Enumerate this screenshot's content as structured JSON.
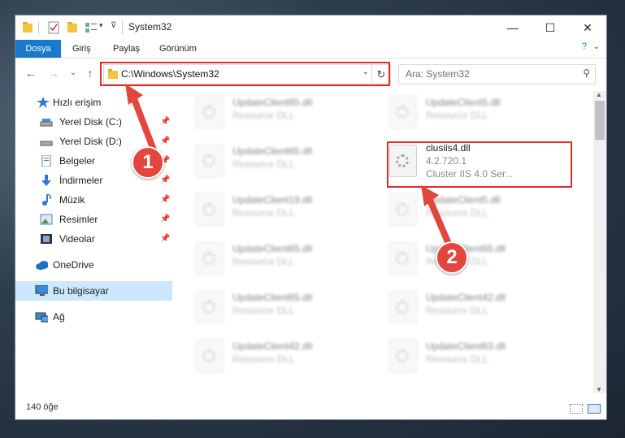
{
  "window": {
    "title": "System32",
    "controls": {
      "minimize": "—",
      "maximize": "☐",
      "close": "✕"
    }
  },
  "ribbon": {
    "tabs": [
      {
        "label": "Dosya"
      },
      {
        "label": "Giriş"
      },
      {
        "label": "Paylaş"
      },
      {
        "label": "Görünüm"
      }
    ]
  },
  "address": {
    "path": "C:\\Windows\\System32",
    "refresh_icon": "↻",
    "dropdown_icon": "⌄"
  },
  "search": {
    "placeholder": "Ara: System32",
    "icon": "⚲"
  },
  "nav_buttons": {
    "back": "←",
    "forward": "→",
    "recent": "⌄",
    "up": "↑"
  },
  "sidebar": {
    "pin_icon": "📌",
    "items": [
      {
        "label": "Hızlı erişim",
        "icon": "star-icon"
      },
      {
        "label": "Yerel Disk (C:)",
        "icon": "drive-icon",
        "pinned": true
      },
      {
        "label": "Yerel Disk (D:)",
        "icon": "drive-icon",
        "pinned": true
      },
      {
        "label": "Belgeler",
        "icon": "documents-icon",
        "pinned": true
      },
      {
        "label": "İndirmeler",
        "icon": "download-icon",
        "pinned": true
      },
      {
        "label": "Müzik",
        "icon": "music-icon",
        "pinned": true
      },
      {
        "label": "Resimler",
        "icon": "pictures-icon",
        "pinned": true
      },
      {
        "label": "Videolar",
        "icon": "videos-icon",
        "pinned": true
      },
      {
        "label": "OneDrive",
        "icon": "cloud-icon"
      },
      {
        "label": "Bu bilgisayar",
        "icon": "computer-icon",
        "selected": true
      },
      {
        "label": "Ağ",
        "icon": "network-icon"
      }
    ]
  },
  "files": [
    {
      "name": "UpdateClient65.dll",
      "desc": "Resource DLL",
      "blurred": true
    },
    {
      "name": "UpdateClient5.dll",
      "desc": "Resource DLL",
      "blurred": true
    },
    {
      "name": "UpdateClient65.dll",
      "desc": "Resource DLL",
      "blurred": true
    },
    {
      "name": "clusiis4.dll",
      "version": "4.2.720.1",
      "desc": "Cluster IIS 4.0 Ser...",
      "blurred": false
    },
    {
      "name": "UpdateClient19.dll",
      "desc": "Resource DLL",
      "blurred": true
    },
    {
      "name": "UpdateClient5.dll",
      "desc": "Resource DLL",
      "blurred": true
    },
    {
      "name": "UpdateClient65.dll",
      "desc": "Resource DLL",
      "blurred": true
    },
    {
      "name": "UpdateClient65.dll",
      "desc": "Resource DLL",
      "blurred": true
    },
    {
      "name": "UpdateClient65.dll",
      "desc": "Resource DLL",
      "blurred": true
    },
    {
      "name": "UpdateClient42.dll",
      "desc": "Resource DLL",
      "blurred": true
    },
    {
      "name": "UpdateClient42.dll",
      "desc": "Resource DLL",
      "blurred": true
    },
    {
      "name": "UpdateClient63.dll",
      "desc": "Resource DLL",
      "blurred": true
    }
  ],
  "status": {
    "count": "140 öğe"
  },
  "annotations": [
    {
      "number": "1"
    },
    {
      "number": "2"
    }
  ],
  "colors": {
    "accent": "#1979ca",
    "highlight": "#e02b2b",
    "badge": "#e3463e",
    "selected": "#cce8ff"
  }
}
